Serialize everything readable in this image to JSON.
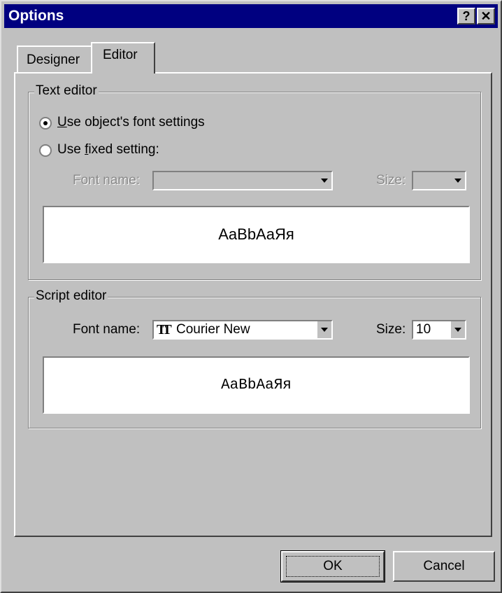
{
  "window": {
    "title": "Options",
    "help_label": "?",
    "close_label": "✕"
  },
  "tabs": [
    {
      "label": "Designer",
      "active": false
    },
    {
      "label": "Editor",
      "active": true
    }
  ],
  "text_editor": {
    "group_label": "Text editor",
    "option_object_font": {
      "label_mnemonic": "U",
      "label_rest": "se object's font settings",
      "checked": true
    },
    "option_fixed": {
      "label_prefix": "Use ",
      "label_mnemonic": "f",
      "label_rest": "ixed setting:",
      "checked": false
    },
    "font_name_label": "Font name:",
    "font_name_value": "",
    "size_label": "Size:",
    "size_value": "",
    "preview_text": "AaBbAaЯя"
  },
  "script_editor": {
    "group_label": "Script editor",
    "font_name_label": "Font name:",
    "font_icon": "truetype-icon",
    "font_icon_glyph": "TT",
    "font_name_value": "Courier New",
    "size_label": "Size:",
    "size_value": "10",
    "preview_text": "AaBbAaЯя"
  },
  "buttons": {
    "ok": "OK",
    "cancel": "Cancel"
  },
  "colors": {
    "titlebar": "#000080",
    "face": "#c0c0c0",
    "disabled_text": "#8a8a8a"
  }
}
